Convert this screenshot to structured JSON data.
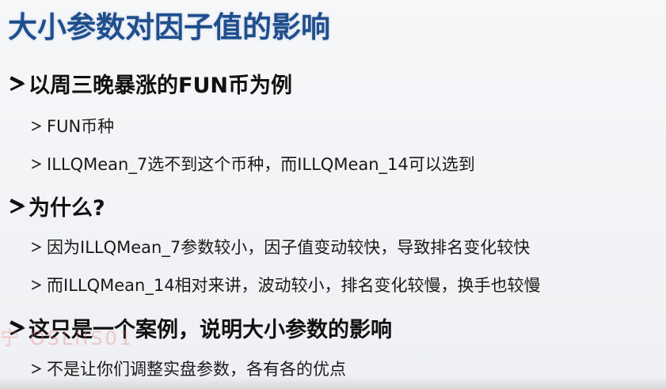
{
  "slide": {
    "title": "大小参数对因子值的影响",
    "watermark": "宁 OSLIIS01",
    "bullets": [
      {
        "level": 1,
        "text": "以周三晚暴涨的FUN币为例"
      },
      {
        "level": 2,
        "text": "FUN币种"
      },
      {
        "level": 2,
        "text": "ILLQMean_7选不到这个币种，而ILLQMean_14可以选到"
      },
      {
        "level": 1,
        "text": "为什么?"
      },
      {
        "level": 2,
        "text": "因为ILLQMean_7参数较小，因子值变动较快，导致排名变化较快"
      },
      {
        "level": 2,
        "text": "而ILLQMean_14相对来讲，波动较小，排名变化较慢，换手也较慢"
      },
      {
        "level": 1,
        "text": "这只是一个案例，说明大小参数的影响"
      },
      {
        "level": 2,
        "text": "不是让你们调整实盘参数，各有各的优点"
      }
    ]
  },
  "colors": {
    "title": "#1f4e8c",
    "text": "#111111",
    "watermark": "#eb7878"
  },
  "icons": {
    "bullet": "arrow-bullet-icon"
  }
}
